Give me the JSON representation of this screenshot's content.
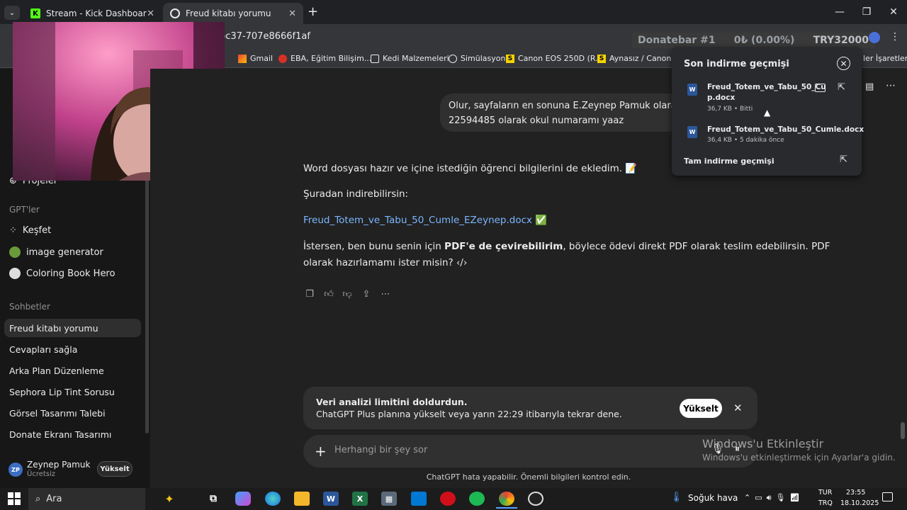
{
  "browser": {
    "tabs": [
      {
        "label": "Stream - Kick Dashboard"
      },
      {
        "label": "Freud kitabı yorumu"
      }
    ],
    "url_fragment": "bc37-707e8666f1af",
    "bookmarks": [
      {
        "label": "Gmail"
      },
      {
        "label": "EBA, Eğitim Bilişim..."
      },
      {
        "label": "Kedi Malzemeleri"
      },
      {
        "label": "Simülasyon"
      },
      {
        "label": "Canon EOS 250D (R..."
      },
      {
        "label": "Aynasız / Canon / E..."
      },
      {
        "label": "ler İşaretleri"
      }
    ]
  },
  "donatebar": {
    "title": "Donatebar #1",
    "progress": "0₺ (0.00%)",
    "goal": "TRY32000"
  },
  "sidebar": {
    "projects_label": "Projeler",
    "gpts_header": "GPT'ler",
    "gpts": [
      {
        "label": "Keşfet"
      },
      {
        "label": "image generator"
      },
      {
        "label": "Coloring Book Hero"
      }
    ],
    "chats_header": "Sohbetler",
    "chats": [
      {
        "label": "Freud kitabı yorumu"
      },
      {
        "label": "Cevapları sağla"
      },
      {
        "label": "Arka Plan Düzenleme"
      },
      {
        "label": "Sephora Lip Tint Sorusu"
      },
      {
        "label": "Görsel Tasarımı Talebi"
      },
      {
        "label": "Donate Ekranı Tasarımı"
      }
    ],
    "user": {
      "initials": "ZP",
      "name": "Zeynep Pamuk",
      "plan": "Ücretsiz",
      "upgrade_label": "Yükselt"
    }
  },
  "conversation": {
    "user_message_line1": "Olur, sayfaların en sonuna E.Zeynep Pamuk olarak ism",
    "user_message_line2": "22594485 olarak okul numaramı yaaz",
    "response_line1": "Word dosyası hazır ve içine istediğin öğrenci bilgilerini de ekledim. 📝",
    "response_line2": "Şuradan indirebilirsin:",
    "file_link": "Freud_Totem_ve_Tabu_50_Cumle_EZeynep.docx",
    "file_link_emoji": "✅",
    "response_line3_a": "İstersen, ben bunu senin için ",
    "response_line3_bold": "PDF'e de çevirebilirim",
    "response_line3_b": ", böylece ödevi direkt PDF olarak teslim edebilirsin. PDF",
    "response_line4": "olarak hazırlamamı ister misin? ‹/›"
  },
  "limit_banner": {
    "title": "Veri analizi limitini doldurdun.",
    "subtitle": "ChatGPT Plus planına yükselt veya yarın 22:29 itibarıyla tekrar dene.",
    "upgrade_label": "Yükselt"
  },
  "composer": {
    "placeholder": "Herhangi bir şey sor"
  },
  "disclaimer": "ChatGPT hata yapabilir. Önemli bilgileri kontrol edin.",
  "activation": {
    "line1": "Windows'u Etkinleştir",
    "line2": "Windows'u etkinleştirmek için Ayarlar'a gidin."
  },
  "downloads": {
    "title": "Son indirme geçmişi",
    "items": [
      {
        "name_line1": "Freud_Totem_ve_Tabu_50_Cu",
        "name_line2": "p.docx",
        "meta": "36,7 KB • Bitti"
      },
      {
        "name_line1": "Freud_Totem_ve_Tabu_50_Cumle.docx",
        "name_line2": "",
        "meta": "36,4 KB • 5 dakika önce"
      }
    ],
    "full_history": "Tam indirme geçmişi"
  },
  "taskbar": {
    "search_label": "Ara",
    "weather": "Soğuk hava",
    "lang1": "TUR",
    "lang2": "TRQ",
    "time": "23:55",
    "date": "18.10.2025"
  }
}
